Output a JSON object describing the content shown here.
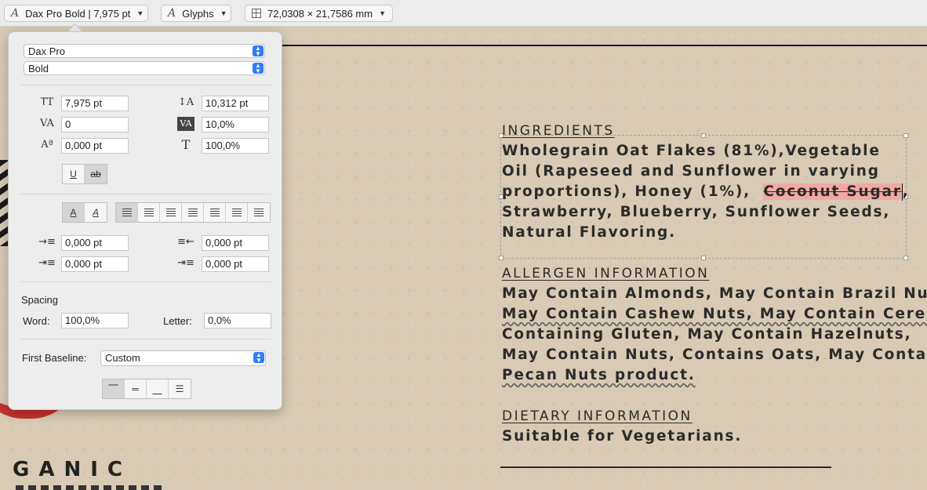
{
  "toolbar": {
    "font_button": "Dax Pro Bold | 7,975 pt",
    "glyphs_button": "Glyphs",
    "size_button": "72,0308 × 21,7586 mm"
  },
  "panel": {
    "font_family": "Dax Pro",
    "font_style": "Bold",
    "font_size": "7,975 pt",
    "leading": "10,312 pt",
    "kerning": "0",
    "tracking": "10,0%",
    "baseline_shift": "0,000 pt",
    "vertical_scale": "100,0%",
    "indent_left": "0,000 pt",
    "indent_right": "0,000 pt",
    "indent_first": "0,000 pt",
    "indent_last": "0,000 pt",
    "spacing_heading": "Spacing",
    "word_label": "Word:",
    "word_value": "100,0%",
    "letter_label": "Letter:",
    "letter_value": "0,0%",
    "first_baseline_label": "First Baseline:",
    "first_baseline_value": "Custom",
    "underline_label": "U",
    "strike_label": "ab"
  },
  "document": {
    "ingredients_heading": "INGREDIENTS",
    "ingredients_lines": [
      "Wholegrain Oat Flakes (81%),Vegetable",
      "Oil (Rapeseed and Sunflower in varying",
      "proportions), Honey (1%),"
    ],
    "ingredients_highlight": "Coconut Sugar",
    "ingredients_tail": ",",
    "ingredients_lines2": [
      "Strawberry, Blueberry, Sunflower Seeds,",
      "Natural Flavoring."
    ],
    "allergen_heading": "ALLERGEN INFORMATION",
    "allergen_lines": [
      "May Contain Almonds, May Contain Brazil Nuts,",
      "May Contain Cashew Nuts, May Contain Cereals",
      "Containing Gluten, May Contain Hazelnuts,",
      "May Contain Nuts, Contains Oats, May Contain",
      "Pecan Nuts product."
    ],
    "dietary_heading": "DIETARY INFORMATION",
    "dietary_line": "Suitable for Vegetarians.",
    "logo_text": "GANIC"
  },
  "colors": {
    "accent": "#2f7cf6",
    "highlight": "#f2a9a3",
    "logo_red": "#c5312c"
  }
}
